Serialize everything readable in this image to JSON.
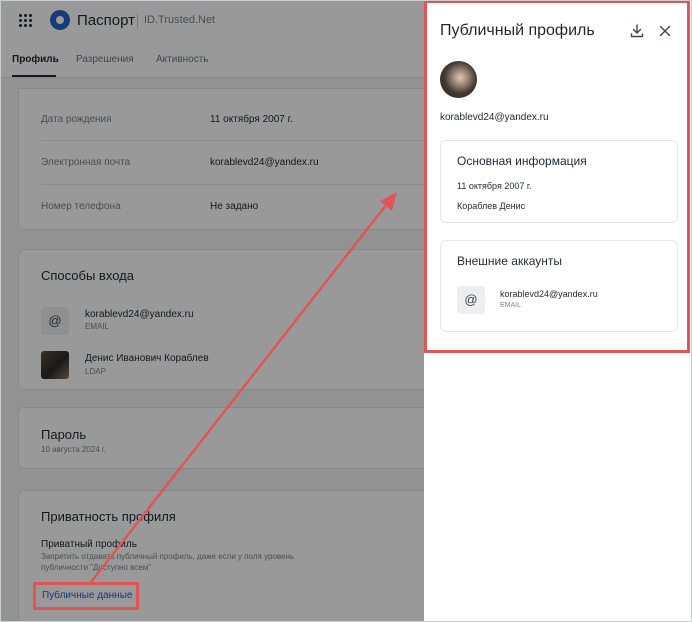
{
  "app": {
    "brand": "Паспорт",
    "subtitle": "ID.Trusted.Net"
  },
  "tabs": [
    {
      "label": "Профиль",
      "active": true
    },
    {
      "label": "Разрешения",
      "active": false
    },
    {
      "label": "Активность",
      "active": false
    }
  ],
  "profile_fields": [
    {
      "label": "Дата рождения",
      "value": "11 октября 2007 г."
    },
    {
      "label": "Электронная почта",
      "value": "korablevd24@yandex.ru"
    },
    {
      "label": "Номер телефона",
      "value": "Не задано"
    }
  ],
  "login_methods": {
    "title": "Способы входа",
    "items": [
      {
        "title": "korablevd24@yandex.ru",
        "subtitle": "EMAIL",
        "icon": "at-icon"
      },
      {
        "title": "Денис Иванович Кораблев",
        "subtitle": "LDAP",
        "icon": "avatar"
      }
    ]
  },
  "password": {
    "title": "Пароль",
    "date": "10 августа 2024 г."
  },
  "privacy": {
    "title": "Приватность профиля",
    "private_label": "Приватный профиль",
    "description_line1": "Запретить отдавать публичный профиль, даже если у поля уровень",
    "description_line2": "публичности \"Доступно всем\"",
    "public_data_link": "Публичные данные"
  },
  "drawer": {
    "title": "Публичный профиль",
    "email": "korablevd24@yandex.ru",
    "basic_info": {
      "title": "Основная информация",
      "birth_date": "11 октября 2007 г.",
      "name": "Кораблев Денис"
    },
    "external_accounts": {
      "title": "Внешние аккаунты",
      "items": [
        {
          "title": "korablevd24@yandex.ru",
          "subtitle": "EMAIL",
          "icon": "at-icon"
        }
      ]
    }
  },
  "colors": {
    "accent": "#2563c9",
    "annotation": "#e05656",
    "overlay": "rgba(0,0,0,0.4)"
  }
}
